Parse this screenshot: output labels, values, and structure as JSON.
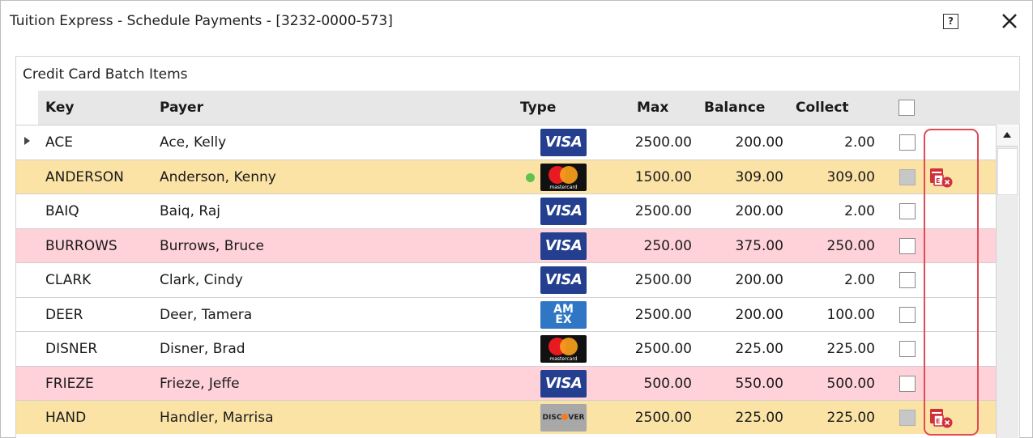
{
  "window": {
    "title": "Tuition Express - Schedule Payments - [3232-0000-573]",
    "help_label": "?",
    "close_icon": "close-icon"
  },
  "panel": {
    "title": "Credit Card Batch Items"
  },
  "columns": {
    "key": "Key",
    "payer": "Payer",
    "type": "Type",
    "max": "Max",
    "balance": "Balance",
    "collect": "Collect"
  },
  "colors": {
    "row_yellow": "#fbe3a6",
    "row_pink": "#ffd2da",
    "highlight": "#e04b55",
    "status_dot": "#5ec24d",
    "error_icon": "#d0303a"
  },
  "card_labels": {
    "visa": "VISA",
    "mastercard": "mastercard",
    "amex_top": "AM",
    "amex_bottom": "EX",
    "discover_left": "DISC",
    "discover_right": "VER"
  },
  "rows": [
    {
      "key": "ACE",
      "payer": "Ace, Kelly",
      "card": "visa",
      "max": "2500.00",
      "balance": "200.00",
      "collect": "2.00",
      "row_color": "white",
      "checkbox": "unchecked",
      "current": true,
      "status_dot": false,
      "error_icon": false
    },
    {
      "key": "ANDERSON",
      "payer": "Anderson, Kenny",
      "card": "mastercard",
      "max": "1500.00",
      "balance": "309.00",
      "collect": "309.00",
      "row_color": "yellow",
      "checkbox": "disabled",
      "current": false,
      "status_dot": true,
      "error_icon": true
    },
    {
      "key": "BAIQ",
      "payer": "Baiq, Raj",
      "card": "visa",
      "max": "2500.00",
      "balance": "200.00",
      "collect": "2.00",
      "row_color": "white",
      "checkbox": "unchecked",
      "current": false,
      "status_dot": false,
      "error_icon": false
    },
    {
      "key": "BURROWS",
      "payer": "Burrows, Bruce",
      "card": "visa",
      "max": "250.00",
      "balance": "375.00",
      "collect": "250.00",
      "row_color": "pink",
      "checkbox": "unchecked",
      "current": false,
      "status_dot": false,
      "error_icon": false
    },
    {
      "key": "CLARK",
      "payer": "Clark, Cindy",
      "card": "visa",
      "max": "2500.00",
      "balance": "200.00",
      "collect": "2.00",
      "row_color": "white",
      "checkbox": "unchecked",
      "current": false,
      "status_dot": false,
      "error_icon": false
    },
    {
      "key": "DEER",
      "payer": "Deer, Tamera",
      "card": "amex",
      "max": "2500.00",
      "balance": "200.00",
      "collect": "100.00",
      "row_color": "white",
      "checkbox": "unchecked",
      "current": false,
      "status_dot": false,
      "error_icon": false
    },
    {
      "key": "DISNER",
      "payer": "Disner, Brad",
      "card": "mastercard",
      "max": "2500.00",
      "balance": "225.00",
      "collect": "225.00",
      "row_color": "white",
      "checkbox": "unchecked",
      "current": false,
      "status_dot": false,
      "error_icon": false
    },
    {
      "key": "FRIEZE",
      "payer": "Frieze, Jeffe",
      "card": "visa",
      "max": "500.00",
      "balance": "550.00",
      "collect": "500.00",
      "row_color": "pink",
      "checkbox": "unchecked",
      "current": false,
      "status_dot": false,
      "error_icon": false
    },
    {
      "key": "HAND",
      "payer": "Handler, Marrisa",
      "card": "discover",
      "max": "2500.00",
      "balance": "225.00",
      "collect": "225.00",
      "row_color": "yellow",
      "checkbox": "disabled",
      "current": false,
      "status_dot": false,
      "error_icon": true
    }
  ]
}
